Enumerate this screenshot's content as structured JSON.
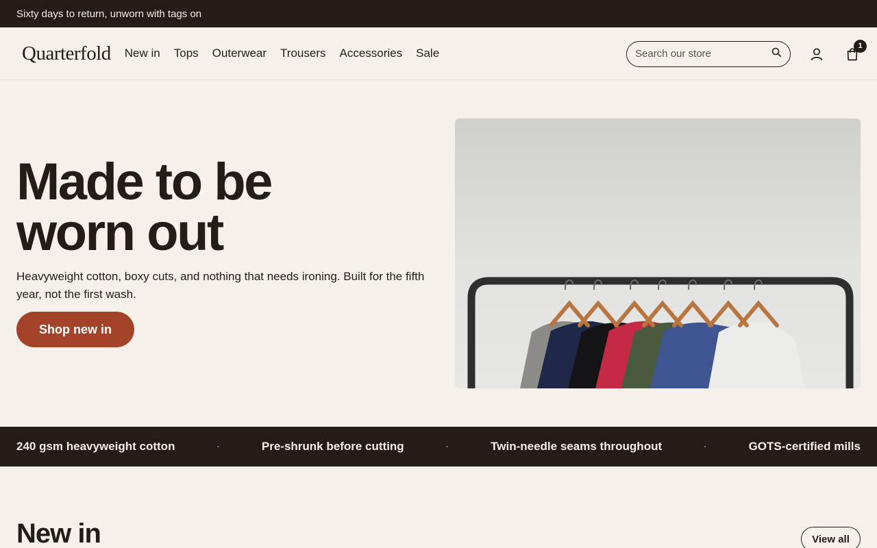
{
  "announcement": "Sixty days to return, unworn with tags on",
  "header": {
    "logo": "Quarterfold",
    "nav": [
      "New in",
      "Tops",
      "Outerwear",
      "Trousers",
      "Accessories",
      "Sale"
    ],
    "search_placeholder": "Search our store",
    "cart_count": "1"
  },
  "hero": {
    "title_line1": "Made to be",
    "title_line2": "worn out",
    "subtitle": "Heavyweight cotton, boxy cuts, and nothing that needs ironing. Built for the fifth year, not the first wash.",
    "cta": "Shop new in"
  },
  "features": [
    "240 gsm heavyweight cotton",
    "Pre-shrunk before cutting",
    "Twin-needle seams throughout",
    "GOTS-certified mills"
  ],
  "new_in": {
    "title": "New in",
    "view_all": "View all"
  },
  "colors": {
    "dark": "#231c18",
    "accent": "#a2432a",
    "background": "#f6f0ea"
  }
}
